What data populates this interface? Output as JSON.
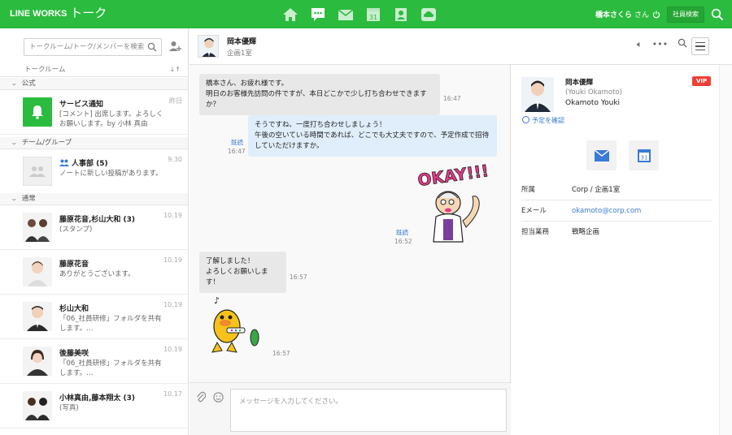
{
  "header": {
    "brand": "LINE WORKS",
    "app": "トーク",
    "nav_icons": [
      "home-icon",
      "talk-icon",
      "mail-icon",
      "calendar-icon",
      "contacts-icon",
      "drive-icon"
    ],
    "user_name": "橋本さくら",
    "user_suffix": "さん",
    "employee_search": "社員検索"
  },
  "sidebar": {
    "search_placeholder": "トークルーム/トーク/メンバーを検索",
    "list_header": "トークルーム",
    "sort_label": "↓↑",
    "sections": {
      "official": "公式",
      "team": "チーム/グループ",
      "normal": "通常"
    },
    "rooms": [
      {
        "name": "サービス通知",
        "message": "[コメント] 出席します。よろしくお願いします。by 小林 真由",
        "time": "昨日"
      },
      {
        "name": "人事部 (5)",
        "message": "ノートに新しい投稿があります。",
        "time": "9.30"
      },
      {
        "name": "藤原花音,杉山大和 (3)",
        "message": "(スタンプ)",
        "time": "10.19"
      },
      {
        "name": "藤原花音",
        "message": "ありがとうございます。",
        "time": "10.19"
      },
      {
        "name": "杉山大和",
        "message": "「06_社員研修」フォルダを共有します。…",
        "time": "10.19"
      },
      {
        "name": "後藤美咲",
        "message": "「06_社員研修」フォルダを共有します。…",
        "time": "10.19"
      },
      {
        "name": "小林真由,藤本翔太 (3)",
        "message": "(写真)",
        "time": "10.17"
      }
    ]
  },
  "chat": {
    "title": "岡本優輝",
    "subtitle": "企画1室",
    "messages": [
      {
        "text1": "橋本さん、お疲れ様です。",
        "text2": "明日のお客様先訪問の件ですが、本日どこかで少し打ち合わせできますか？",
        "time": "16:47"
      },
      {
        "text1": "そうですね、一度打ち合わせしましょう！",
        "text2": "午後の空いている時間であれば、どこでも大丈夫ですので、予定作成で招待していただけますか。",
        "time": "16:47",
        "read": "既読"
      },
      {
        "sticker_text": "OKAY!!!",
        "time": "16:52",
        "read": "既読"
      },
      {
        "text1": "了解しました！",
        "text2": "よろしくお願いします！",
        "time": "16:57"
      },
      {
        "time": "16:57"
      }
    ],
    "input_placeholder": "メッセージを入力してください。"
  },
  "profile": {
    "name": "岡本優輝",
    "romaji": "(Youki Okamoto)",
    "english": "Okamoto Youki",
    "badge": "VIP",
    "schedule_link": "予定を確認",
    "fields": [
      {
        "key": "所属",
        "value": "Corp  / 企画1室"
      },
      {
        "key": "Eメール",
        "value": "okamoto@corp.com"
      },
      {
        "key": "担当業務",
        "value": "戦略企画"
      }
    ]
  },
  "colors": {
    "brand_green": "#2bbb3e",
    "vip_red": "#ee4036",
    "link_blue": "#3a7bd5"
  }
}
